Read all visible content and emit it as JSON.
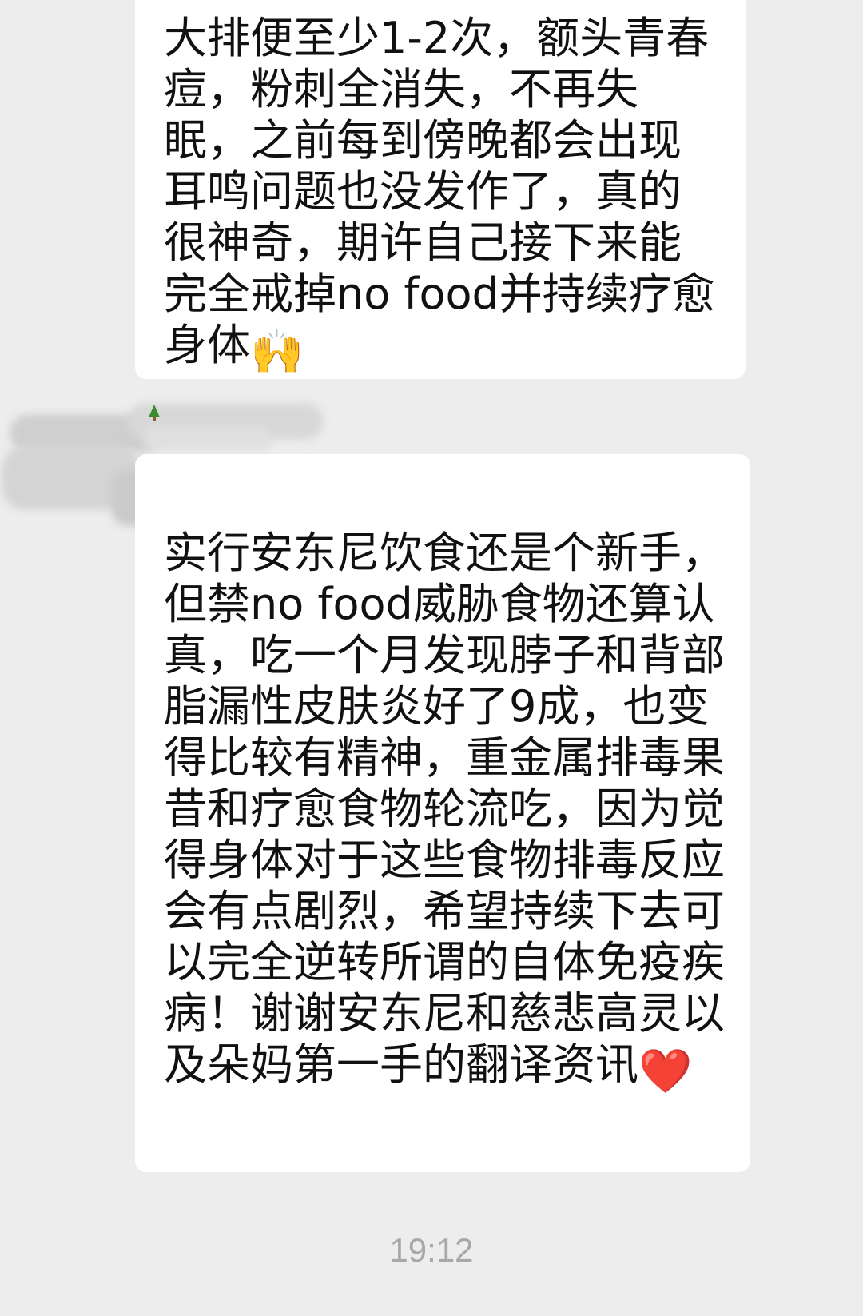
{
  "chat": {
    "messages": [
      {
        "text": "大排便至少1-2次，额头青春痘，粉刺全消失，不再失眠，之前每到傍晚都会出现耳鸣问题也没发作了，真的很神奇，期许自己接下来能完全戒掉no food并持续疗愈身体",
        "emoji": "🙌"
      },
      {
        "text": "实行安东尼饮食还是个新手，但禁no food威胁食物还算认真，吃一个月发现脖子和背部脂漏性皮肤炎好了9成，也变得比较有精神，重金属排毒果昔和疗愈食物轮流吃，因为觉得身体对于这些食物排毒反应会有点剧烈，希望持续下去可以完全逆转所谓的自体免疫疾病！谢谢安东尼和慈悲高灵以及朵妈第一手的翻译资讯",
        "emoji": "❤️"
      }
    ],
    "timestamp": "19:12"
  },
  "colors": {
    "background": "#ededed",
    "bubble": "#ffffff",
    "text": "#111111",
    "timestamp": "#a8a8a8"
  }
}
